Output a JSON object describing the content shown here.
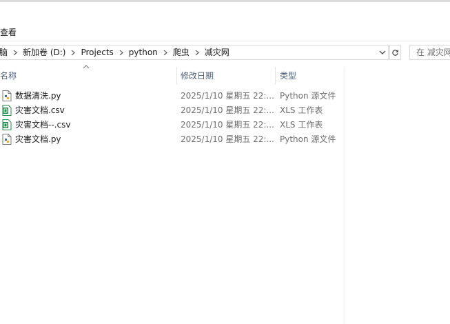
{
  "toolbar": {
    "view_menu": "查看"
  },
  "address": {
    "crumbs": [
      "脑",
      "新加卷 (D:)",
      "Projects",
      "python",
      "爬虫",
      "减灾网"
    ]
  },
  "search": {
    "placeholder": "在 减灾网"
  },
  "columns": {
    "name": "名称",
    "date": "修改日期",
    "type": "类型"
  },
  "files": [
    {
      "name": "数据清洗.py",
      "date": "2025/1/10 星期五 22:...",
      "type": "Python 源文件",
      "icon": "python-file-icon"
    },
    {
      "name": "灾害文档.csv",
      "date": "2025/1/10 星期五 22:...",
      "type": "XLS 工作表",
      "icon": "spreadsheet-file-icon"
    },
    {
      "name": "灾害文档--.csv",
      "date": "2025/1/10 星期五 22:...",
      "type": "XLS 工作表",
      "icon": "spreadsheet-file-icon"
    },
    {
      "name": "灾害文档.py",
      "date": "2025/1/10 星期五 22:...",
      "type": "Python 源文件",
      "icon": "python-file-icon"
    }
  ],
  "colors": {
    "header_text": "#4c607a",
    "muted_text": "#6d6d6d",
    "spreadsheet_green": "#1d8e4a",
    "python_blue": "#3572a5"
  }
}
